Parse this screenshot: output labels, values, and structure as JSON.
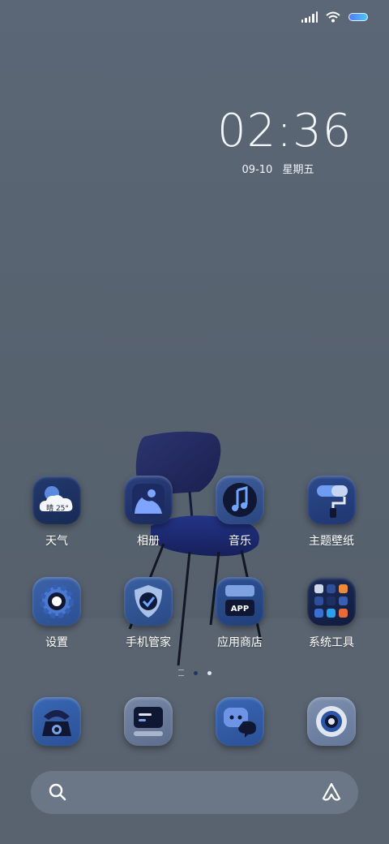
{
  "status_bar": {
    "signal_icon": "cellular-signal-icon",
    "wifi_icon": "wifi-icon",
    "battery_icon": "battery-icon",
    "battery_color": "#4f7cff"
  },
  "clock": {
    "time": "02:36",
    "date": "09-10",
    "weekday": "星期五"
  },
  "apps": [
    {
      "label": "天气",
      "icon": "weather-icon",
      "badge": "晴 25°"
    },
    {
      "label": "相册",
      "icon": "gallery-icon"
    },
    {
      "label": "音乐",
      "icon": "music-icon"
    },
    {
      "label": "主题壁纸",
      "icon": "theme-wallpaper-icon"
    },
    {
      "label": "设置",
      "icon": "settings-gear-icon"
    },
    {
      "label": "手机管家",
      "icon": "phone-manager-shield-icon"
    },
    {
      "label": "应用商店",
      "icon": "app-store-icon",
      "badge": "APP"
    },
    {
      "label": "系统工具",
      "icon": "system-tools-icon"
    }
  ],
  "page_indicator": {
    "pages": 3,
    "current": 2
  },
  "dock": [
    {
      "icon": "phone-icon"
    },
    {
      "icon": "browser-icon"
    },
    {
      "icon": "messages-icon"
    },
    {
      "icon": "camera-icon"
    }
  ],
  "search_bar": {
    "search_icon": "search-icon",
    "assistant_icon": "assistant-icon"
  },
  "colors": {
    "accent": "#1e3a8a",
    "icon_base": "#2d4f8f"
  }
}
